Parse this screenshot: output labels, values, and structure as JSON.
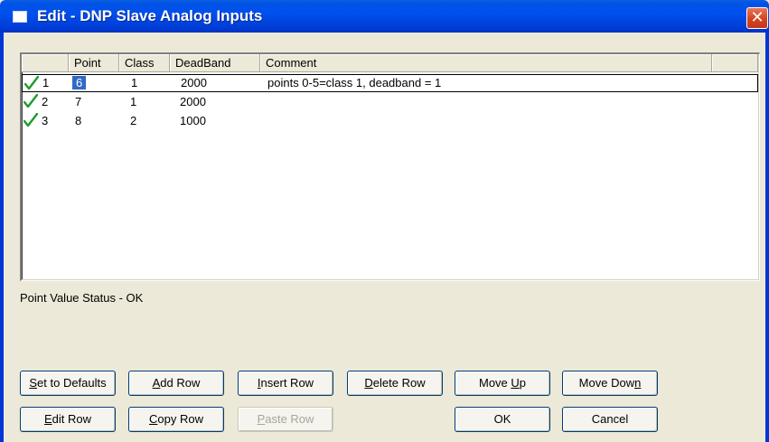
{
  "window": {
    "title": "Edit - DNP Slave Analog Inputs",
    "close_glyph": "✕"
  },
  "table": {
    "columns": [
      "Point",
      "Class",
      "DeadBand",
      "Comment"
    ],
    "rows": [
      {
        "index": "1",
        "point": "6",
        "class": "1",
        "deadband": "2000",
        "comment": "points 0-5=class 1, deadband = 1",
        "selected": true
      },
      {
        "index": "2",
        "point": "7",
        "class": "1",
        "deadband": "2000",
        "comment": "",
        "selected": false
      },
      {
        "index": "3",
        "point": "8",
        "class": "2",
        "deadband": "1000",
        "comment": "",
        "selected": false
      }
    ]
  },
  "status": "Point Value Status - OK",
  "buttons": {
    "set_defaults": {
      "pre": "",
      "key": "S",
      "post": "et to Defaults"
    },
    "add_row": {
      "pre": "",
      "key": "A",
      "post": "dd Row"
    },
    "insert_row": {
      "pre": "",
      "key": "I",
      "post": "nsert Row"
    },
    "delete_row": {
      "pre": "",
      "key": "D",
      "post": "elete Row"
    },
    "move_up": {
      "pre": "Move ",
      "key": "U",
      "post": "p"
    },
    "move_down": {
      "pre": "Move Dow",
      "key": "n",
      "post": ""
    },
    "edit_row": {
      "pre": "",
      "key": "E",
      "post": "dit Row"
    },
    "copy_row": {
      "pre": "",
      "key": "C",
      "post": "opy Row"
    },
    "paste_row": {
      "pre": "",
      "key": "P",
      "post": "aste Row"
    },
    "ok": {
      "pre": "OK",
      "key": "",
      "post": ""
    },
    "cancel": {
      "pre": "Cancel",
      "key": "",
      "post": ""
    }
  },
  "colors": {
    "title_bar": "#0050ee",
    "selection": "#316ac5",
    "check": "#1e9c2a",
    "dialog_bg": "#ece9d8"
  },
  "icons": {
    "title": "window-icon",
    "row_status": "check-mark-icon"
  }
}
